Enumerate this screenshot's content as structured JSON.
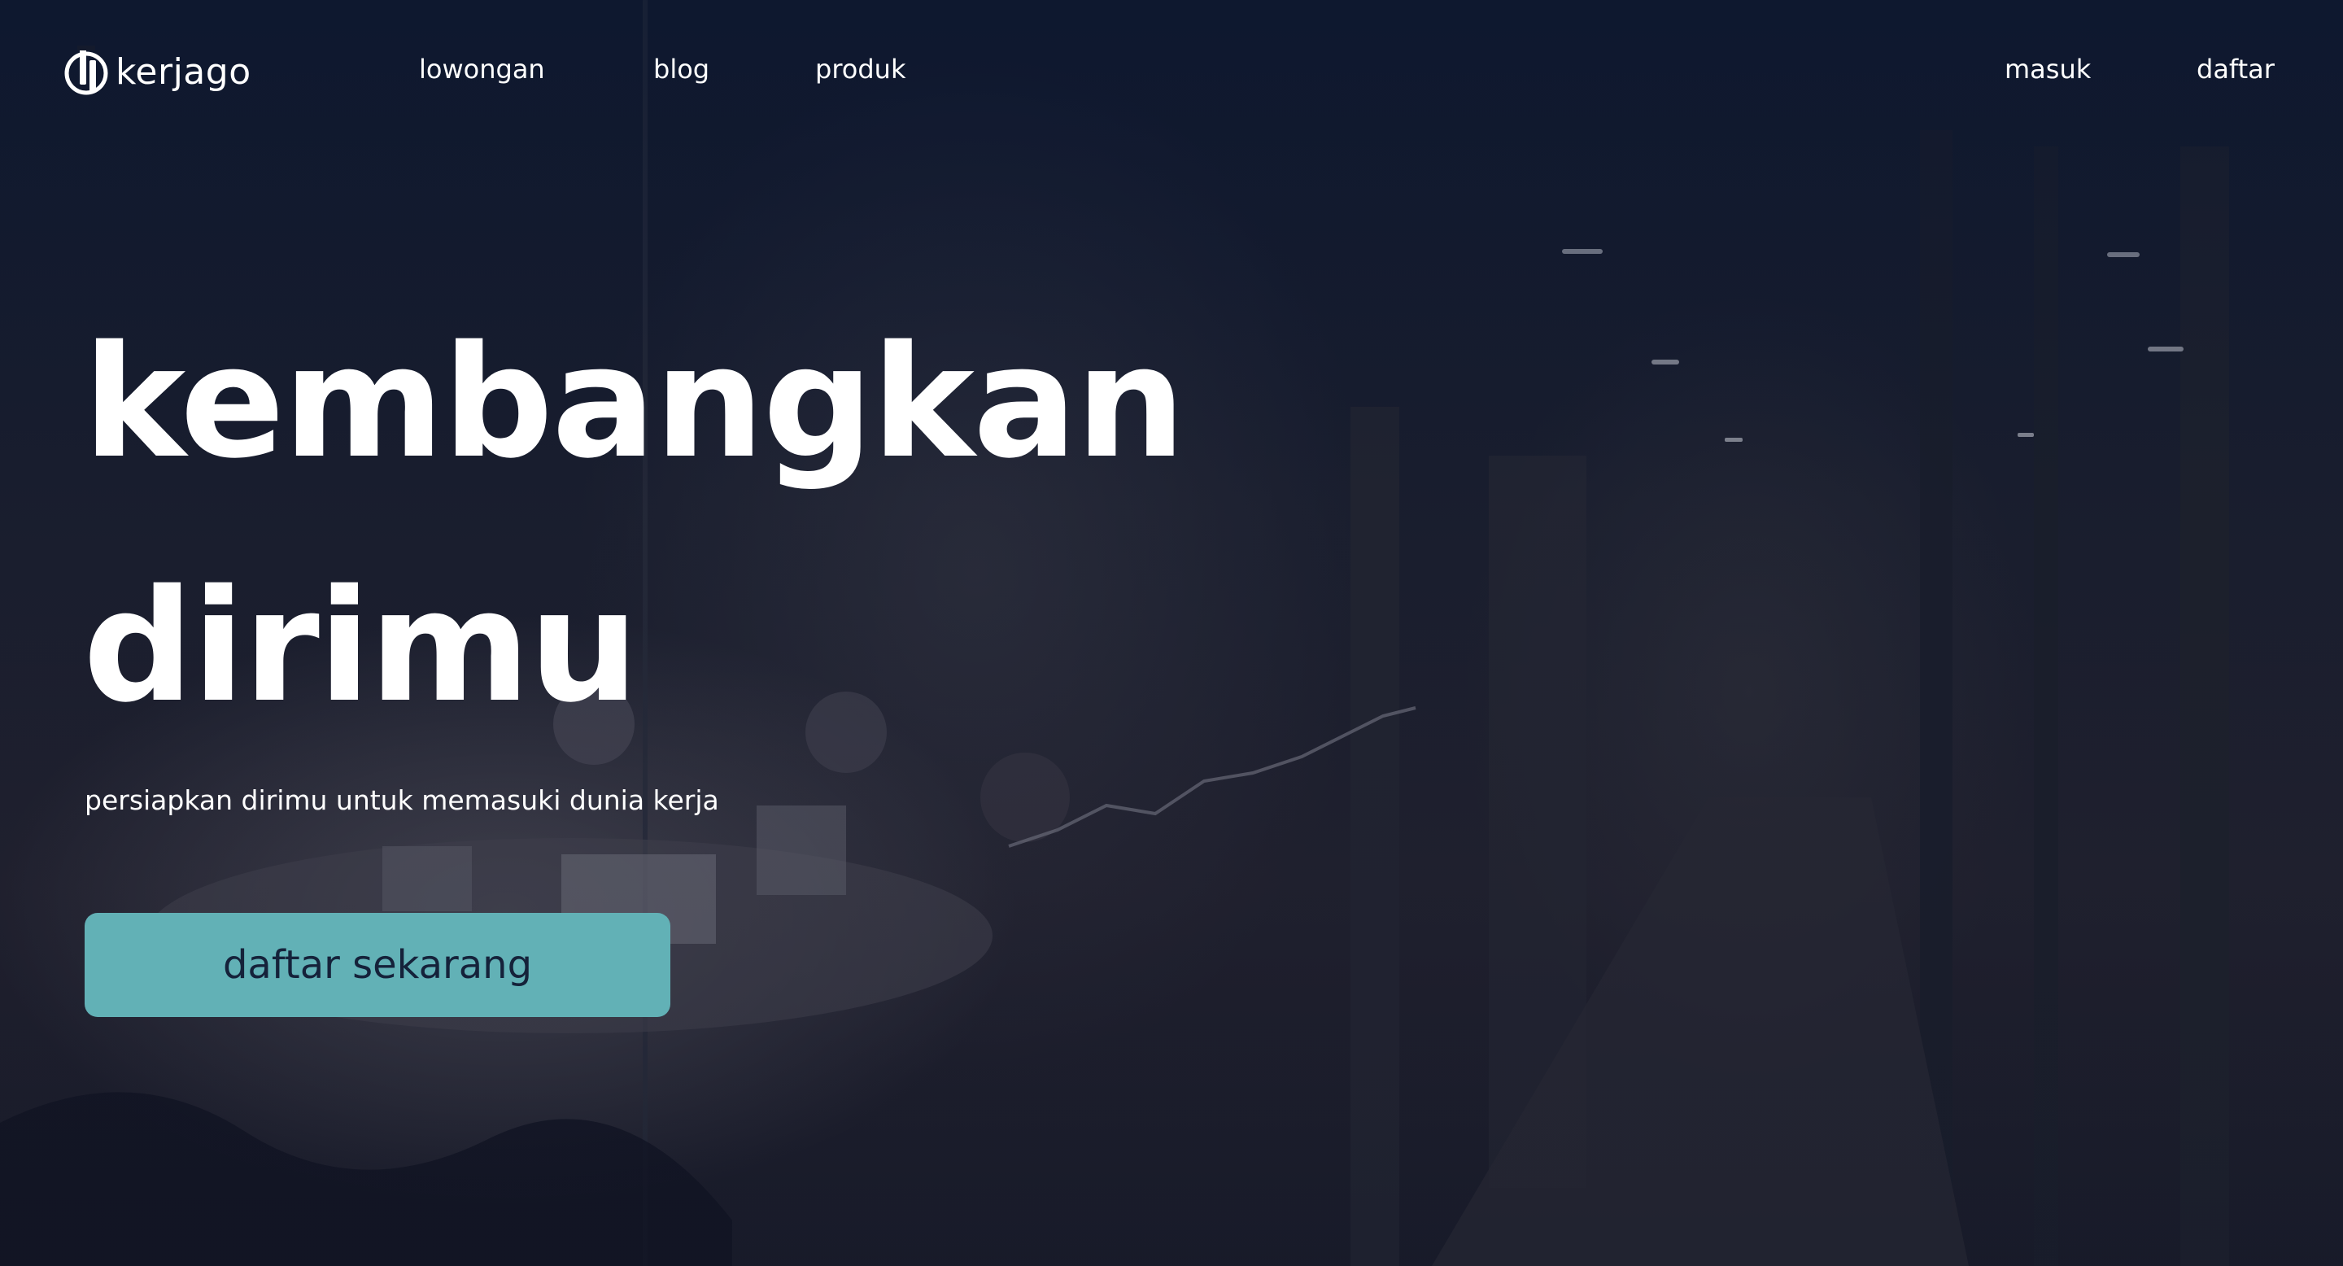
{
  "brand": {
    "name": "kerjago"
  },
  "nav": {
    "links": [
      {
        "label": "lowongan"
      },
      {
        "label": "blog"
      },
      {
        "label": "produk"
      }
    ],
    "auth": {
      "login": "masuk",
      "register": "daftar"
    }
  },
  "hero": {
    "headline_line1": "kembangkan",
    "headline_line2": "dirimu",
    "subtitle": "persiapkan dirimu untuk memasuki dunia kerja",
    "cta_label": "daftar sekarang",
    "background": "dim photo of people working in a glass-walled office corridor"
  },
  "colors": {
    "cta_background": "#62b1b6",
    "cta_text": "#15223a",
    "nav_text": "#ffffff",
    "overlay": "#0b1630"
  }
}
